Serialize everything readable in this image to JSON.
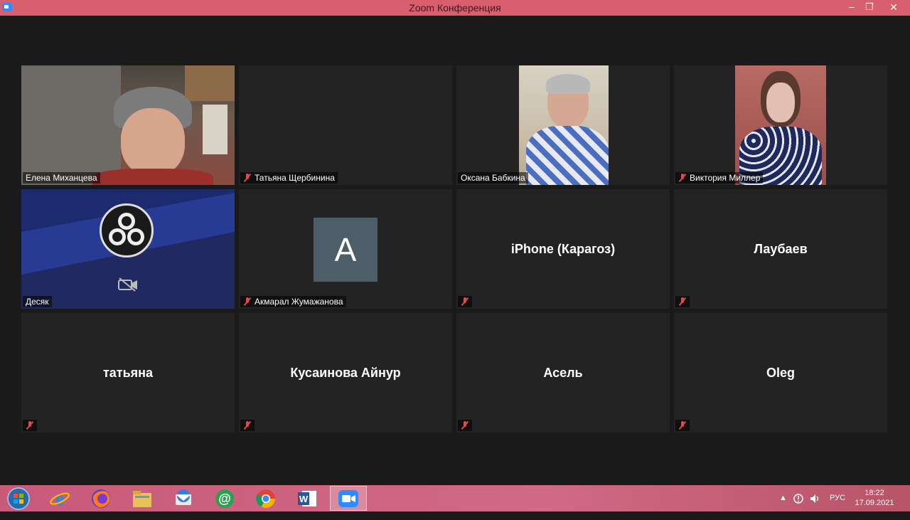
{
  "window": {
    "title": "Zoom Конференция",
    "minimize": "–",
    "maximize": "❐",
    "close": "✕"
  },
  "gallery": {
    "tiles": [
      {
        "name": "Елена Миханцева",
        "muted": false,
        "video": true,
        "active": true
      },
      {
        "name": "Татьяна Щербинина",
        "muted": true,
        "video": false
      },
      {
        "name": "Оксана Бабкина",
        "muted": false,
        "video": true
      },
      {
        "name": "Виктория Миллер",
        "muted": true,
        "video": true
      },
      {
        "name": "Десяк",
        "muted": false,
        "video": false
      },
      {
        "name": "Акмарал Жумажанова",
        "muted": true,
        "video": false,
        "avatar_letter": "A"
      },
      {
        "name": "iPhone (Карагоз)",
        "muted": true,
        "video": false
      },
      {
        "name": "Лаубаев",
        "muted": true,
        "video": false
      },
      {
        "name": "татьяна",
        "muted": true,
        "video": false
      },
      {
        "name": "Кусаинова Айнур",
        "muted": true,
        "video": false
      },
      {
        "name": "Асель",
        "muted": true,
        "video": false
      },
      {
        "name": "Oleg",
        "muted": true,
        "video": false
      }
    ]
  },
  "taskbar": {
    "apps": [
      "start-orb-icon",
      "ie-icon",
      "firefox-icon",
      "file-explorer-icon",
      "thunderbird-icon",
      "mail-at-icon",
      "chrome-icon",
      "word-icon",
      "zoom-icon"
    ],
    "language": "РУС",
    "time": "18:22",
    "date": "17.09.2021"
  },
  "colors": {
    "titlebar": "#d85f6e",
    "active_speaker": "#c9e265",
    "tile_bg": "#232323",
    "muted_red": "#e04a4a"
  }
}
